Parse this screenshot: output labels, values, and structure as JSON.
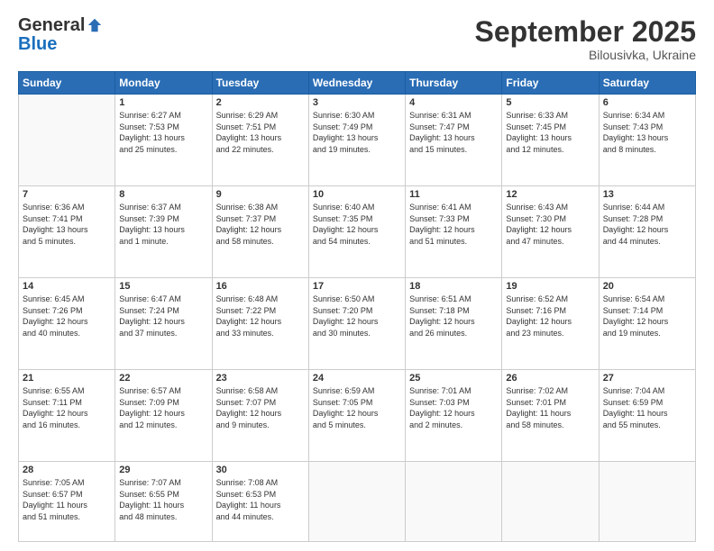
{
  "logo": {
    "general": "General",
    "blue": "Blue"
  },
  "header": {
    "month": "September 2025",
    "location": "Bilousivka, Ukraine"
  },
  "days_of_week": [
    "Sunday",
    "Monday",
    "Tuesday",
    "Wednesday",
    "Thursday",
    "Friday",
    "Saturday"
  ],
  "weeks": [
    [
      {
        "day": "",
        "info": ""
      },
      {
        "day": "1",
        "info": "Sunrise: 6:27 AM\nSunset: 7:53 PM\nDaylight: 13 hours\nand 25 minutes."
      },
      {
        "day": "2",
        "info": "Sunrise: 6:29 AM\nSunset: 7:51 PM\nDaylight: 13 hours\nand 22 minutes."
      },
      {
        "day": "3",
        "info": "Sunrise: 6:30 AM\nSunset: 7:49 PM\nDaylight: 13 hours\nand 19 minutes."
      },
      {
        "day": "4",
        "info": "Sunrise: 6:31 AM\nSunset: 7:47 PM\nDaylight: 13 hours\nand 15 minutes."
      },
      {
        "day": "5",
        "info": "Sunrise: 6:33 AM\nSunset: 7:45 PM\nDaylight: 13 hours\nand 12 minutes."
      },
      {
        "day": "6",
        "info": "Sunrise: 6:34 AM\nSunset: 7:43 PM\nDaylight: 13 hours\nand 8 minutes."
      }
    ],
    [
      {
        "day": "7",
        "info": "Sunrise: 6:36 AM\nSunset: 7:41 PM\nDaylight: 13 hours\nand 5 minutes."
      },
      {
        "day": "8",
        "info": "Sunrise: 6:37 AM\nSunset: 7:39 PM\nDaylight: 13 hours\nand 1 minute."
      },
      {
        "day": "9",
        "info": "Sunrise: 6:38 AM\nSunset: 7:37 PM\nDaylight: 12 hours\nand 58 minutes."
      },
      {
        "day": "10",
        "info": "Sunrise: 6:40 AM\nSunset: 7:35 PM\nDaylight: 12 hours\nand 54 minutes."
      },
      {
        "day": "11",
        "info": "Sunrise: 6:41 AM\nSunset: 7:33 PM\nDaylight: 12 hours\nand 51 minutes."
      },
      {
        "day": "12",
        "info": "Sunrise: 6:43 AM\nSunset: 7:30 PM\nDaylight: 12 hours\nand 47 minutes."
      },
      {
        "day": "13",
        "info": "Sunrise: 6:44 AM\nSunset: 7:28 PM\nDaylight: 12 hours\nand 44 minutes."
      }
    ],
    [
      {
        "day": "14",
        "info": "Sunrise: 6:45 AM\nSunset: 7:26 PM\nDaylight: 12 hours\nand 40 minutes."
      },
      {
        "day": "15",
        "info": "Sunrise: 6:47 AM\nSunset: 7:24 PM\nDaylight: 12 hours\nand 37 minutes."
      },
      {
        "day": "16",
        "info": "Sunrise: 6:48 AM\nSunset: 7:22 PM\nDaylight: 12 hours\nand 33 minutes."
      },
      {
        "day": "17",
        "info": "Sunrise: 6:50 AM\nSunset: 7:20 PM\nDaylight: 12 hours\nand 30 minutes."
      },
      {
        "day": "18",
        "info": "Sunrise: 6:51 AM\nSunset: 7:18 PM\nDaylight: 12 hours\nand 26 minutes."
      },
      {
        "day": "19",
        "info": "Sunrise: 6:52 AM\nSunset: 7:16 PM\nDaylight: 12 hours\nand 23 minutes."
      },
      {
        "day": "20",
        "info": "Sunrise: 6:54 AM\nSunset: 7:14 PM\nDaylight: 12 hours\nand 19 minutes."
      }
    ],
    [
      {
        "day": "21",
        "info": "Sunrise: 6:55 AM\nSunset: 7:11 PM\nDaylight: 12 hours\nand 16 minutes."
      },
      {
        "day": "22",
        "info": "Sunrise: 6:57 AM\nSunset: 7:09 PM\nDaylight: 12 hours\nand 12 minutes."
      },
      {
        "day": "23",
        "info": "Sunrise: 6:58 AM\nSunset: 7:07 PM\nDaylight: 12 hours\nand 9 minutes."
      },
      {
        "day": "24",
        "info": "Sunrise: 6:59 AM\nSunset: 7:05 PM\nDaylight: 12 hours\nand 5 minutes."
      },
      {
        "day": "25",
        "info": "Sunrise: 7:01 AM\nSunset: 7:03 PM\nDaylight: 12 hours\nand 2 minutes."
      },
      {
        "day": "26",
        "info": "Sunrise: 7:02 AM\nSunset: 7:01 PM\nDaylight: 11 hours\nand 58 minutes."
      },
      {
        "day": "27",
        "info": "Sunrise: 7:04 AM\nSunset: 6:59 PM\nDaylight: 11 hours\nand 55 minutes."
      }
    ],
    [
      {
        "day": "28",
        "info": "Sunrise: 7:05 AM\nSunset: 6:57 PM\nDaylight: 11 hours\nand 51 minutes."
      },
      {
        "day": "29",
        "info": "Sunrise: 7:07 AM\nSunset: 6:55 PM\nDaylight: 11 hours\nand 48 minutes."
      },
      {
        "day": "30",
        "info": "Sunrise: 7:08 AM\nSunset: 6:53 PM\nDaylight: 11 hours\nand 44 minutes."
      },
      {
        "day": "",
        "info": ""
      },
      {
        "day": "",
        "info": ""
      },
      {
        "day": "",
        "info": ""
      },
      {
        "day": "",
        "info": ""
      }
    ]
  ]
}
